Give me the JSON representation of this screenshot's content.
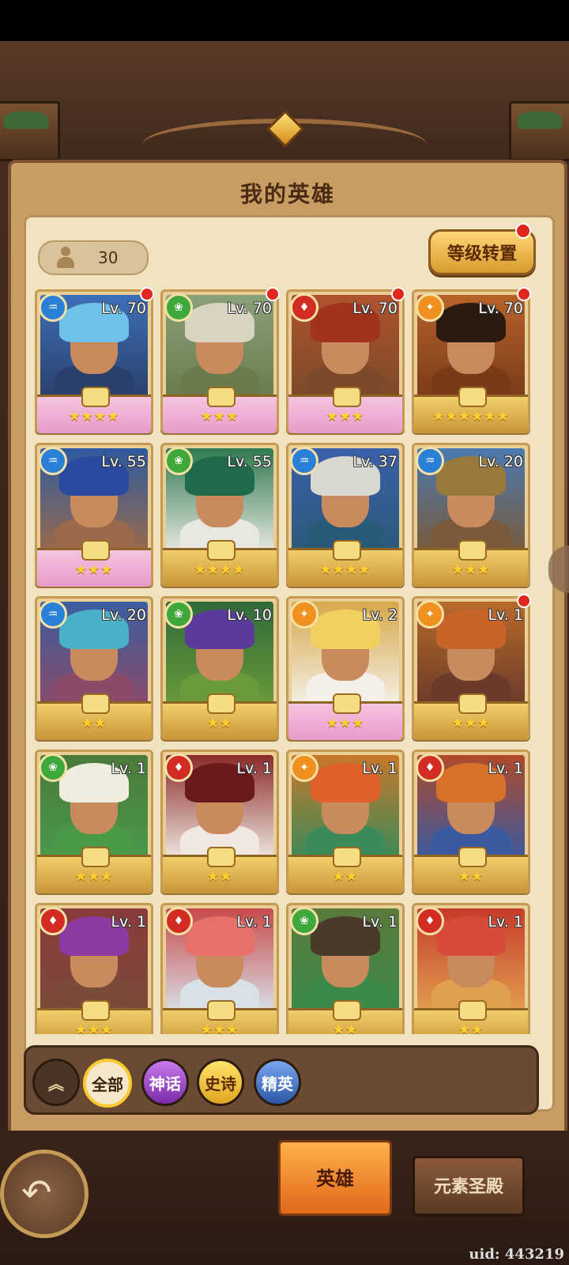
{
  "page": {
    "title": "我的英雄",
    "hero_count": "30",
    "level_transfer_label": "等级转置",
    "uid_label": "uid: 443219"
  },
  "filters": [
    {
      "label": "全部"
    },
    {
      "label": "神话"
    },
    {
      "label": "史诗"
    },
    {
      "label": "精英"
    }
  ],
  "bottom_tabs": {
    "hero": "英雄",
    "shrine": "元素圣殿"
  },
  "heroes": [
    {
      "level": "Lv. 70",
      "element": "water",
      "stars": "★★★★",
      "dot": true,
      "wing": true,
      "palette": [
        "#3c6fb8",
        "#6fc1e8",
        "#2a3f6a"
      ]
    },
    {
      "level": "Lv. 70",
      "element": "earth",
      "stars": "★★★",
      "dot": true,
      "wing": true,
      "palette": [
        "#8aa07a",
        "#d8d4c0",
        "#6a7c4c"
      ]
    },
    {
      "level": "Lv. 70",
      "element": "fire",
      "stars": "★★★",
      "dot": true,
      "wing": true,
      "palette": [
        "#b0532e",
        "#a0321e",
        "#7a4a2a"
      ]
    },
    {
      "level": "Lv. 70",
      "element": "light",
      "stars": "★★★★★★",
      "dot": true,
      "wing": false,
      "palette": [
        "#b7632a",
        "#2a1a10",
        "#7a3a1a"
      ]
    },
    {
      "level": "Lv. 55",
      "element": "water",
      "stars": "★★★",
      "dot": false,
      "wing": true,
      "palette": [
        "#2d5aa0",
        "#2a4aa0",
        "#9a6a4a"
      ]
    },
    {
      "level": "Lv. 55",
      "element": "earth",
      "stars": "★★★★",
      "dot": false,
      "wing": false,
      "palette": [
        "#2f7a4f",
        "#1f6a4a",
        "#e8e8e0"
      ]
    },
    {
      "level": "Lv. 37",
      "element": "water",
      "stars": "★★★★",
      "dot": false,
      "wing": false,
      "palette": [
        "#3a60a8",
        "#d8d8d0",
        "#2a5a7a"
      ]
    },
    {
      "level": "Lv. 20",
      "element": "water",
      "stars": "★★★",
      "dot": false,
      "wing": false,
      "palette": [
        "#4a7ab0",
        "#9a7a3a",
        "#7a5a3a"
      ]
    },
    {
      "level": "Lv. 20",
      "element": "water",
      "stars": "★★",
      "dot": false,
      "wing": false,
      "palette": [
        "#3a5ea0",
        "#4ab0c8",
        "#8a4a6a"
      ]
    },
    {
      "level": "Lv. 10",
      "element": "earth",
      "stars": "★★",
      "dot": false,
      "wing": false,
      "palette": [
        "#2f6a3a",
        "#5a3a9a",
        "#6a9a3a"
      ]
    },
    {
      "level": "Lv. 2",
      "element": "light",
      "stars": "★★★",
      "dot": false,
      "wing": true,
      "palette": [
        "#d8a84a",
        "#f0d060",
        "#f4f0e8"
      ]
    },
    {
      "level": "Lv. 1",
      "element": "light",
      "stars": "★★★",
      "dot": true,
      "wing": false,
      "palette": [
        "#b86a2a",
        "#c8642a",
        "#6a3a2a"
      ]
    },
    {
      "level": "Lv. 1",
      "element": "earth",
      "stars": "★★★",
      "dot": false,
      "wing": false,
      "palette": [
        "#4a7a3a",
        "#f0ece0",
        "#4a9a4a"
      ]
    },
    {
      "level": "Lv. 1",
      "element": "fire",
      "stars": "★★",
      "dot": false,
      "wing": false,
      "palette": [
        "#8a2a2a",
        "#6a1a1a",
        "#f0e8e0"
      ]
    },
    {
      "level": "Lv. 1",
      "element": "light",
      "stars": "★★",
      "dot": false,
      "wing": false,
      "palette": [
        "#c8782a",
        "#e0602a",
        "#3a8a5a"
      ]
    },
    {
      "level": "Lv. 1",
      "element": "fire",
      "stars": "★★",
      "dot": false,
      "wing": false,
      "palette": [
        "#b04a2a",
        "#d8702a",
        "#3a5aa0"
      ]
    },
    {
      "level": "Lv. 1",
      "element": "fire",
      "stars": "★★★",
      "dot": false,
      "wing": false,
      "palette": [
        "#8a3a3a",
        "#8a3aa0",
        "#7a4a3a"
      ]
    },
    {
      "level": "Lv. 1",
      "element": "fire",
      "stars": "★★★",
      "dot": false,
      "wing": false,
      "palette": [
        "#c84a4a",
        "#e8706a",
        "#d8e0e8"
      ]
    },
    {
      "level": "Lv. 1",
      "element": "earth",
      "stars": "★★",
      "dot": false,
      "wing": false,
      "palette": [
        "#5a7a3a",
        "#4a3a2a",
        "#3a8a4a"
      ]
    },
    {
      "level": "Lv. 1",
      "element": "fire",
      "stars": "★★",
      "dot": false,
      "wing": false,
      "palette": [
        "#c83a2a",
        "#d84a3a",
        "#e0a050"
      ]
    }
  ]
}
